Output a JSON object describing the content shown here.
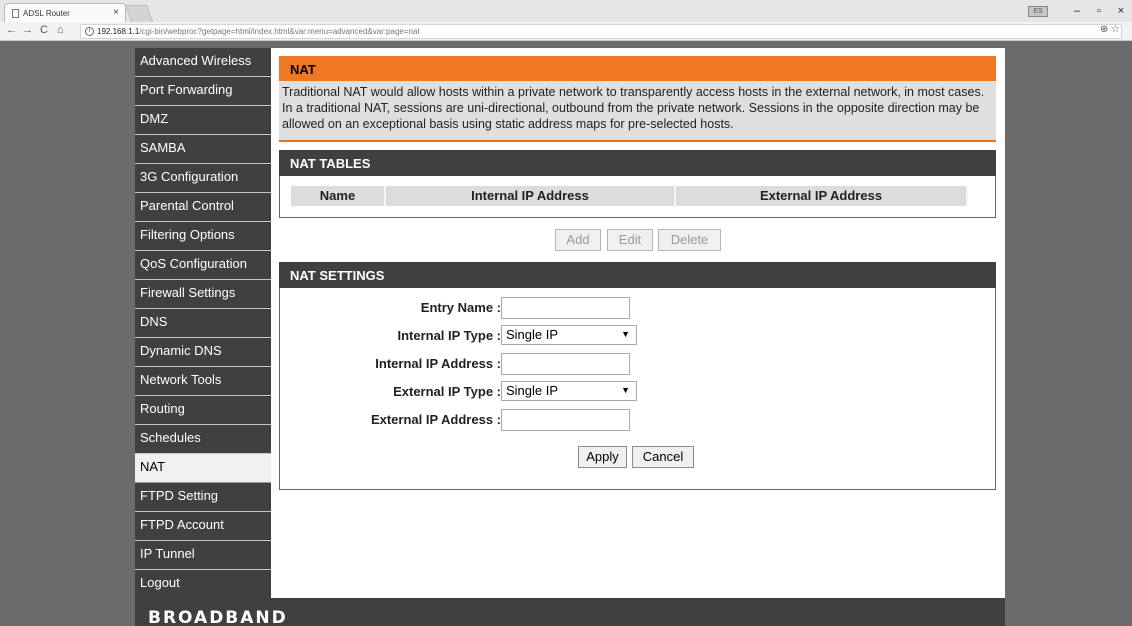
{
  "browser": {
    "tab_title": "ADSL Router",
    "tab_close": "×",
    "window_badge": "ES",
    "minimize": "–",
    "maximize": "▫",
    "close": "×",
    "back": "←",
    "forward": "→",
    "reload": "C",
    "home": "⌂",
    "url_host": "192.168.1.1",
    "url_path": "/cgi-bin/webproc?getpage=html/index.html&var:menu=advanced&var:page=nat",
    "addr_icons": "⊕ ☆"
  },
  "sidebar": {
    "items": [
      {
        "label": "Advanced Wireless"
      },
      {
        "label": "Port Forwarding"
      },
      {
        "label": "DMZ"
      },
      {
        "label": "SAMBA"
      },
      {
        "label": "3G Configuration"
      },
      {
        "label": "Parental Control"
      },
      {
        "label": "Filtering Options"
      },
      {
        "label": "QoS Configuration"
      },
      {
        "label": "Firewall Settings"
      },
      {
        "label": "DNS"
      },
      {
        "label": "Dynamic DNS"
      },
      {
        "label": "Network Tools"
      },
      {
        "label": "Routing"
      },
      {
        "label": "Schedules"
      },
      {
        "label": "NAT"
      },
      {
        "label": "FTPD Setting"
      },
      {
        "label": "FTPD Account"
      },
      {
        "label": "IP Tunnel"
      },
      {
        "label": "Logout"
      }
    ],
    "active": "NAT"
  },
  "nat": {
    "title": "NAT",
    "description": "Traditional NAT would allow hosts within a private network to transparently access hosts in the external network, in most cases. In a traditional NAT, sessions are uni-directional, outbound from the private network. Sessions in the opposite direction may be allowed on an exceptional basis using static address maps for pre-selected hosts."
  },
  "nat_tables": {
    "title": "NAT TABLES",
    "columns": [
      "Name",
      "Internal IP Address",
      "External IP Address"
    ],
    "buttons": {
      "add": "Add",
      "edit": "Edit",
      "delete": "Delete"
    }
  },
  "nat_settings": {
    "title": "NAT SETTINGS",
    "entry_name_label": "Entry Name :",
    "entry_name_value": "",
    "internal_ip_type_label": "Internal IP Type :",
    "internal_ip_type_value": "Single IP",
    "internal_ip_address_label": "Internal IP Address :",
    "internal_ip_address_value": "",
    "external_ip_type_label": "External IP Type :",
    "external_ip_type_value": "Single IP",
    "external_ip_address_label": "External IP Address :",
    "external_ip_address_value": "",
    "apply": "Apply",
    "cancel": "Cancel"
  },
  "footer": {
    "brand": "BROADBAND"
  },
  "colors": {
    "accent": "#f07824",
    "header_dark": "#404040",
    "sidebar_active": "#f0f0f0"
  }
}
